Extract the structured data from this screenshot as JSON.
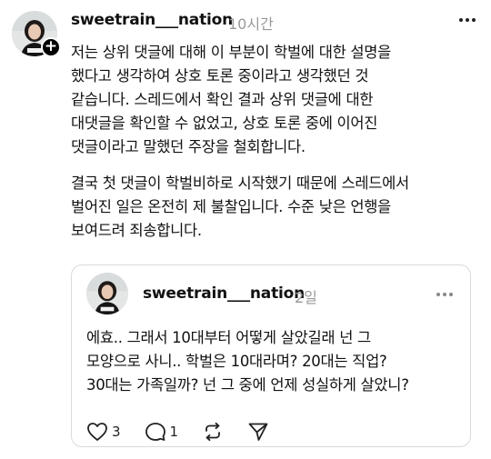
{
  "post": {
    "username": "sweetrain___nation",
    "time": "10시간",
    "paragraphs": [
      "저는 상위 댓글에 대해 이 부분이 학벌에 대한 설명을\n했다고 생각하여 상호 토론 중이라고 생각했던 것\n같습니다. 스레드에서 확인 결과 상위 댓글에 대한\n대댓글을 확인할 수 없었고,  상호 토론 중에 이어진\n댓글이라고 말했던 주장을 철회합니다.",
      "결국 첫 댓글이 학벌비하로 시작했기 때문에 스레드에서\n벌어진 일은 온전히 제 불찰입니다. 수준 낮은 언행을\n보여드려 죄송합니다."
    ],
    "follow_symbol": "+"
  },
  "quoted": {
    "username": "sweetrain___nation",
    "time": "2일",
    "text": "에효.. 그래서 10대부터 어떻게 살았길래 넌 그\n모양으로 사니.. 학벌은 10대라며? 20대는 직업?\n30대는 가족일까? 넌 그 중에 언제 성실하게 살았니?",
    "actions": {
      "like_count": "3",
      "reply_count": "1"
    }
  },
  "icons": {
    "more": "more-horizontal-icon",
    "like": "heart-icon",
    "reply": "comment-bubble-icon",
    "repost": "repost-icon",
    "share": "send-icon"
  }
}
